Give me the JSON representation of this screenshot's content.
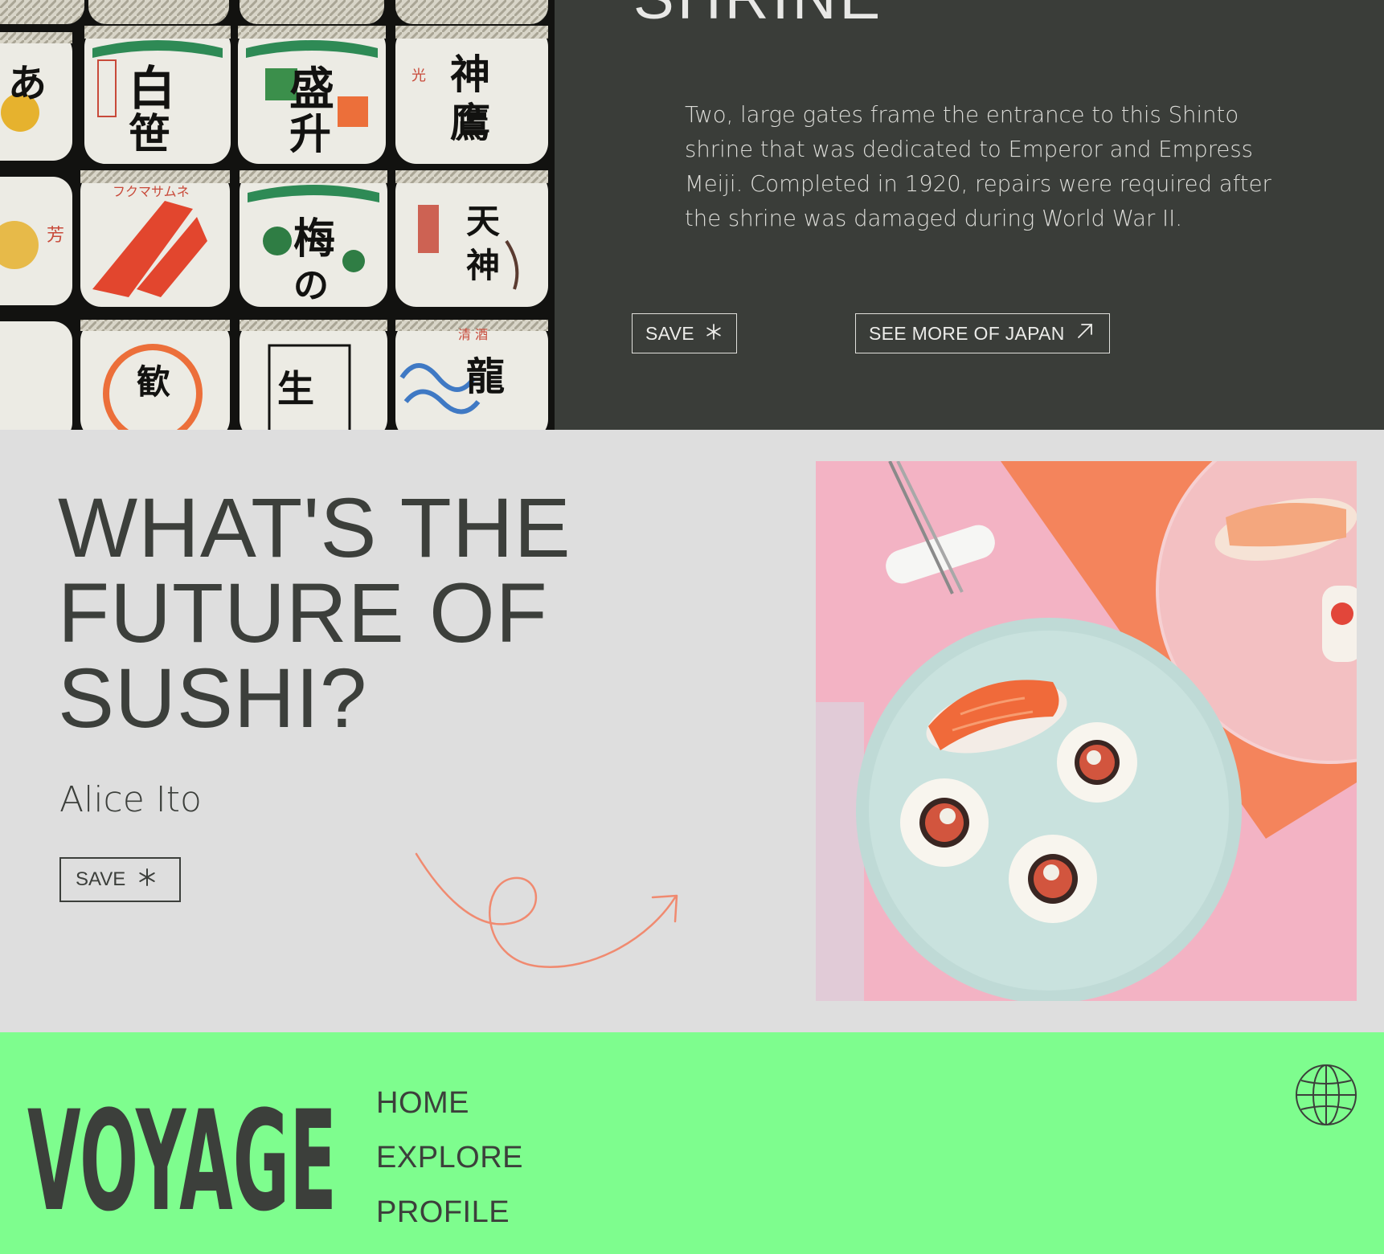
{
  "shrine": {
    "title": "SHRINE",
    "description": "Two, large gates frame the entrance to this Shinto shrine that was dedicated to Emperor and Empress Meiji. Completed in 1920, repairs were required after the shrine was damaged during World War II.",
    "save_label": "SAVE",
    "save_icon": "asterisk-icon",
    "more_label": "SEE MORE OF JAPAN",
    "more_icon": "arrow-up-right-icon",
    "image": "sake-barrels-photo"
  },
  "article": {
    "headline_lines": [
      "WHAT'S THE",
      "FUTURE OF",
      "SUSHI?"
    ],
    "author": "Alice Ito",
    "save_label": "SAVE",
    "save_icon": "asterisk-icon",
    "image": "sushi-plate-photo",
    "accent_color": "#f08a70"
  },
  "footer": {
    "logo": "VOYAGE",
    "nav": [
      "HOME",
      "EXPLORE",
      "PROFILE"
    ],
    "globe_icon": "globe-icon",
    "background": "#7efd8e"
  }
}
